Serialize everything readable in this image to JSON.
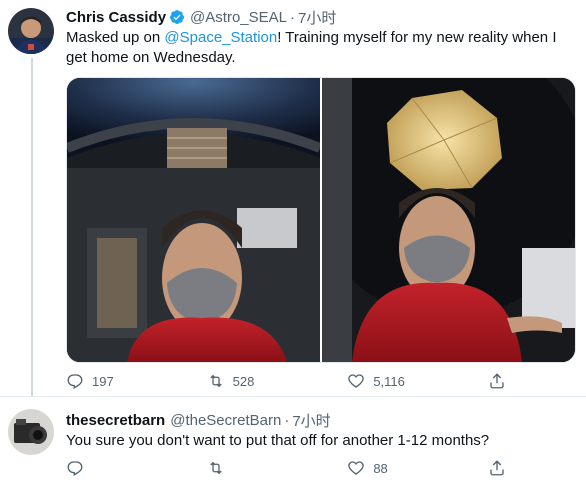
{
  "tweet": {
    "author_name": "Chris Cassidy",
    "author_handle": "@Astro_SEAL",
    "separator": "·",
    "time": "7小时",
    "text_before_mention": "Masked up on ",
    "mention": "@Space_Station",
    "text_after_mention": "! Training myself for my new reality when I get home on Wednesday.",
    "reply_count": "197",
    "retweet_count": "528",
    "like_count": "5,116",
    "verified_icon": "verified-badge-icon",
    "accent_color": "#1da1f2"
  },
  "reply": {
    "author_name": "thesecretbarn",
    "author_handle": "@theSecretBarn",
    "separator": "·",
    "time": "7小时",
    "text": "You sure you don't want to put that off for another 1-12 months?",
    "like_count": "88"
  },
  "icons": {
    "reply": "reply-icon",
    "retweet": "retweet-icon",
    "like": "heart-icon",
    "share": "share-icon"
  }
}
